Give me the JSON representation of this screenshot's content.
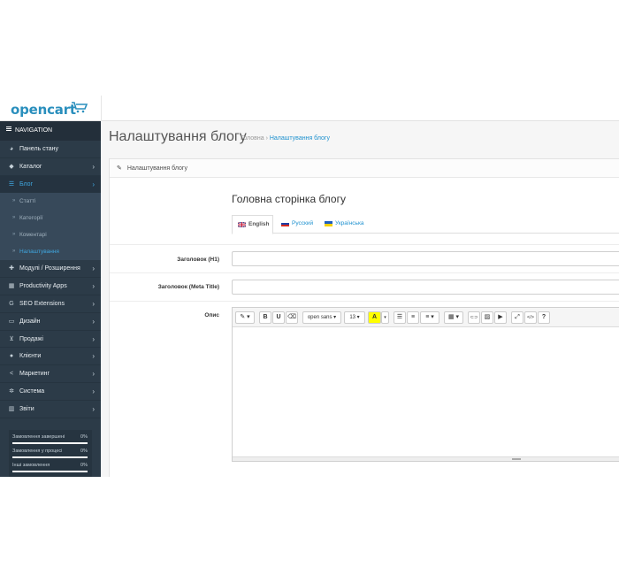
{
  "header": {
    "logo_text": "opencart"
  },
  "sidebar": {
    "title": "NAVIGATION",
    "items": [
      {
        "label": "Панель стану",
        "icon": "dashboard-icon",
        "glyph": "◕",
        "has_children": false
      },
      {
        "label": "Каталог",
        "icon": "tag-icon",
        "glyph": "◆",
        "has_children": true
      },
      {
        "label": "Блог",
        "icon": "list-icon",
        "glyph": "☰",
        "has_children": true,
        "active": true,
        "children": [
          {
            "label": "Статті"
          },
          {
            "label": "Категорії"
          },
          {
            "label": "Коментарі"
          },
          {
            "label": "Налаштування",
            "current": true
          }
        ]
      },
      {
        "label": "Модулі / Розширення",
        "icon": "puzzle-icon",
        "glyph": "✚",
        "has_children": true
      },
      {
        "label": "Productivity Apps",
        "icon": "grid-icon",
        "glyph": "▦",
        "has_children": true
      },
      {
        "label": "SEO Extensions",
        "icon": "google-icon",
        "glyph": "G",
        "has_children": true
      },
      {
        "label": "Дизайн",
        "icon": "desktop-icon",
        "glyph": "▭",
        "has_children": true
      },
      {
        "label": "Продажі",
        "icon": "cart-icon",
        "glyph": "⊻",
        "has_children": true
      },
      {
        "label": "Клієнти",
        "icon": "user-icon",
        "glyph": "●",
        "has_children": true
      },
      {
        "label": "Маркетинг",
        "icon": "share-icon",
        "glyph": "<",
        "has_children": true
      },
      {
        "label": "Система",
        "icon": "cog-icon",
        "glyph": "✲",
        "has_children": true
      },
      {
        "label": "Звіти",
        "icon": "bar-chart-icon",
        "glyph": "▥",
        "has_children": true
      }
    ],
    "stats": [
      {
        "label": "Замовлення завершені",
        "percent": "0%",
        "value": 0
      },
      {
        "label": "Замовлення у процесі",
        "percent": "0%",
        "value": 0
      },
      {
        "label": "Інші замовлення",
        "percent": "0%",
        "value": 0
      }
    ]
  },
  "main": {
    "page_title": "Налаштування блогу",
    "breadcrumb": [
      "Головна",
      "Налаштування блогу"
    ],
    "breadcrumb_sep": "›",
    "panel_heading": "Налаштування блогу",
    "section_title": "Головна сторінка блогу",
    "language_tabs": [
      {
        "label": "English",
        "active": true
      },
      {
        "label": "Русский",
        "active": false
      },
      {
        "label": "Українська",
        "active": false
      }
    ],
    "fields": {
      "h1_label": "Заголовок (H1)",
      "h1_value": "",
      "meta_title_label": "Заголовок (Meta Title)",
      "meta_title_value": "",
      "description_label": "Опис"
    },
    "editor_toolbar": {
      "style": "✎ ▾",
      "bold": "B",
      "underline": "U",
      "eraser": "⌫",
      "font_family": "open sans ▾",
      "font_size": "13 ▾",
      "color": "A",
      "color_caret": "▾",
      "unordered_list": "☰",
      "ordered_list": "≡",
      "paragraph": "≡ ▾",
      "table": "▦ ▾",
      "link": "⊂⊃",
      "picture": "▨",
      "video": "▶",
      "fullscreen": "⤢",
      "code": "</>",
      "help": "?"
    }
  },
  "colors": {
    "sidebar_bg": "#2c3b48",
    "active_accent": "#3fa7e0",
    "link": "#1e91cf",
    "brand": "#2a8fbd"
  }
}
